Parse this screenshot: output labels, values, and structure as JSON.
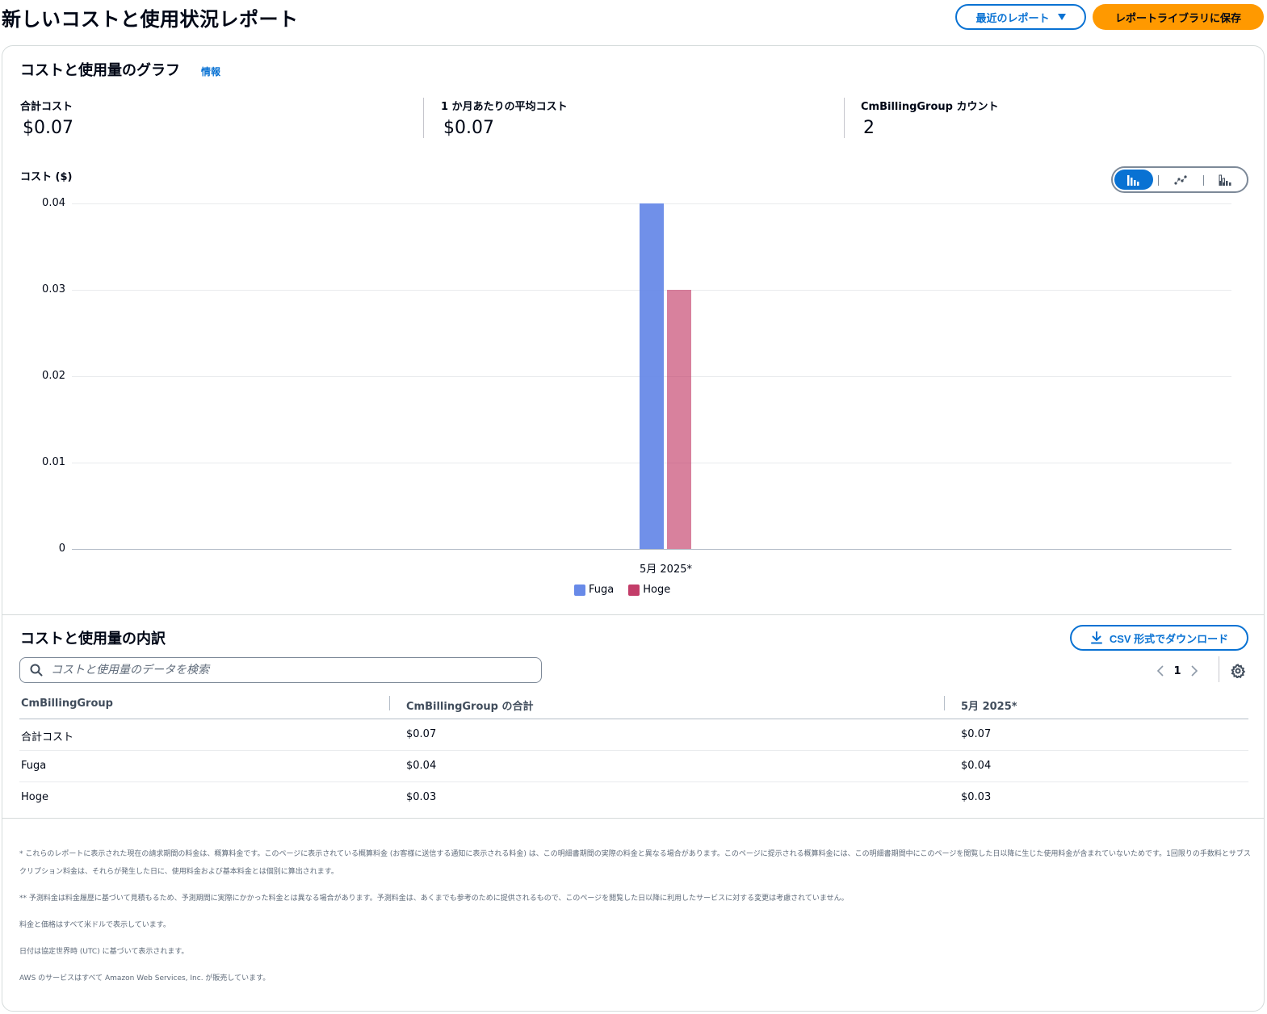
{
  "header": {
    "title": "新しいコストと使用状況レポート",
    "recent_reports_label": "最近のレポート",
    "save_label": "レポートライブラリに保存"
  },
  "graph": {
    "title": "コストと使用量のグラフ",
    "info_label": "情報",
    "metrics": [
      {
        "label": "合計コスト",
        "value": "$0.07"
      },
      {
        "label": "1 か月あたりの平均コスト",
        "value": "$0.07"
      },
      {
        "label": "CmBillingGroup カウント",
        "value": "2"
      }
    ],
    "chart_types": [
      "bar-chart-icon",
      "line-chart-icon",
      "stacked-bar-chart-icon"
    ],
    "active_chart_type": "bar-chart-icon"
  },
  "chart_data": {
    "type": "bar",
    "ylabel": "コスト ($)",
    "categories": [
      "5月 2025*"
    ],
    "series": [
      {
        "name": "Fuga",
        "values": [
          0.04
        ],
        "color": "#688ae8"
      },
      {
        "name": "Hoge",
        "values": [
          0.03
        ],
        "color": "#c33d69"
      }
    ],
    "y_ticks": [
      "0",
      "0.01",
      "0.02",
      "0.03",
      "0.04"
    ],
    "ylim": [
      0,
      0.04
    ],
    "grid": true,
    "legend_position": "bottom-center"
  },
  "breakdown": {
    "title": "コストと使用量の内訳",
    "csv_label": "CSV 形式でダウンロード",
    "search_placeholder": "コストと使用量のデータを検索",
    "pagination": {
      "current_page": "1"
    },
    "columns": [
      "CmBillingGroup",
      "CmBillingGroup の合計",
      "5月 2025*"
    ],
    "rows": [
      [
        "合計コスト",
        "$0.07",
        "$0.07"
      ],
      [
        "Fuga",
        "$0.04",
        "$0.04"
      ],
      [
        "Hoge",
        "$0.03",
        "$0.03"
      ]
    ]
  },
  "footnotes": [
    "* これらのレポートに表示された現在の請求期間の料金は、概算料金です。このページに表示されている概算料金 (お客様に送信する通知に表示される料金) は、この明細書期間の実際の料金と異なる場合があります。このページに提示される概算料金には、この明細書期間中にこのページを閲覧した日以降に生じた使用料金が含まれていないためです。1回限りの手数料とサブスクリプション料金は、それらが発生した日に、使用料金および基本料金とは個別に算出されます。",
    "** 予測料金は料金履歴に基づいて見積もるため、予測期間に実際にかかった料金とは異なる場合があります。予測料金は、あくまでも参考のために提供されるもので、このページを閲覧した日以降に利用したサービスに対する変更は考慮されていません。",
    "料金と価格はすべて米ドルで表示しています。",
    "日付は協定世界時 (UTC) に基づいて表示されます。",
    "AWS のサービスはすべて Amazon Web Services, Inc. が販売しています。"
  ]
}
